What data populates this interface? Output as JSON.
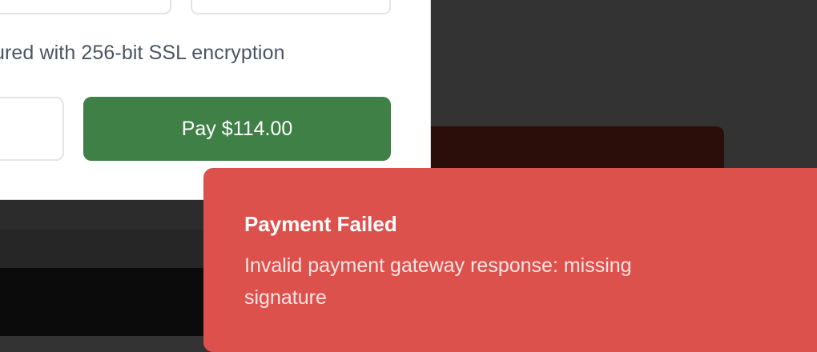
{
  "checkout": {
    "security_note": "ured with 256-bit SSL encryption",
    "pay_button_label": "Pay $114.00"
  },
  "toast": {
    "title": "Payment Failed",
    "message": "Invalid payment gateway response: missing signature"
  },
  "colors": {
    "pay_button": "#3e8046",
    "toast_background": "#dc514c",
    "overlay": "#333333"
  }
}
